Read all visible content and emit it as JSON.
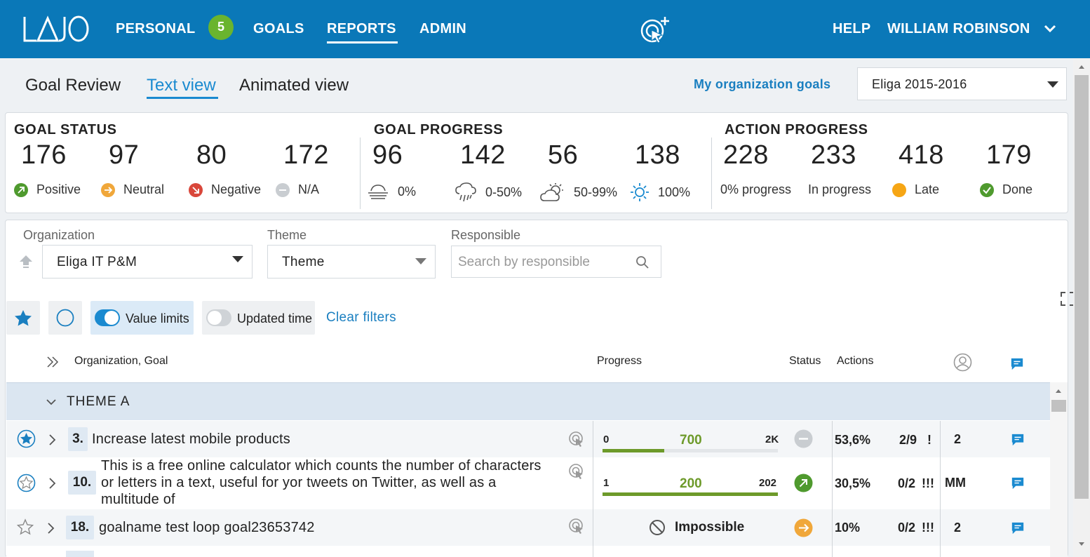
{
  "nav": {
    "logo_text": "LAJO",
    "personal": "PERSONAL",
    "personal_badge": "5",
    "goals": "GOALS",
    "reports": "REPORTS",
    "admin": "ADMIN",
    "help": "HELP",
    "user": "WILLIAM ROBINSON"
  },
  "header": {
    "title": "Goal Review",
    "tab_text": "Text view",
    "tab_animated": "Animated view",
    "org_goals_link": "My organization goals",
    "period": "Eliga 2015-2016"
  },
  "stats": {
    "goal_status": {
      "title": "GOAL STATUS",
      "items": [
        {
          "value": "176",
          "label": "Positive",
          "color": "#4f9a2e"
        },
        {
          "value": "97",
          "label": "Neutral",
          "color": "#f0a73a"
        },
        {
          "value": "80",
          "label": "Negative",
          "color": "#d9473b"
        },
        {
          "value": "172",
          "label": "N/A",
          "color": "#c9cdd1"
        }
      ]
    },
    "goal_progress": {
      "title": "GOAL PROGRESS",
      "items": [
        {
          "value": "96",
          "label": "0%",
          "icon": "fog-icon"
        },
        {
          "value": "142",
          "label": "0-50%",
          "icon": "rain-cloud-icon"
        },
        {
          "value": "56",
          "label": "50-99%",
          "icon": "partly-cloudy-icon"
        },
        {
          "value": "138",
          "label": "100%",
          "icon": "sun-icon"
        }
      ]
    },
    "action_progress": {
      "title": "ACTION PROGRESS",
      "items": [
        {
          "value": "228",
          "label": "0% progress"
        },
        {
          "value": "233",
          "label": "In progress"
        },
        {
          "value": "418",
          "label": "Late",
          "color": "#f6a615"
        },
        {
          "value": "179",
          "label": "Done",
          "color": "#4f9a2e"
        }
      ]
    }
  },
  "filters": {
    "organization_label": "Organization",
    "organization_value": "Eliga IT P&M",
    "theme_label": "Theme",
    "theme_value": "Theme",
    "responsible_label": "Responsible",
    "responsible_placeholder": "Search by responsible",
    "value_limits": "Value limits",
    "updated_time": "Updated time",
    "clear_filters": "Clear filters"
  },
  "table": {
    "headers": {
      "goal": "Organization, Goal",
      "progress": "Progress",
      "status": "Status",
      "actions": "Actions"
    },
    "theme": "THEME A",
    "rows": [
      {
        "no": "3.",
        "title": "Increase latest mobile products",
        "min": "0",
        "value": "700",
        "max": "2K",
        "progress": 0.35,
        "status": "na",
        "actions_pct": "53,6%",
        "actions_count": "2/9",
        "flag": "!",
        "resp": "2"
      },
      {
        "no": "10.",
        "title": "This is a free online calculator which counts the number of characters or letters in a text, useful for yor tweets on Twitter, as well as a multitude of",
        "min": "1",
        "value": "200",
        "max": "202",
        "progress": 1.0,
        "status": "positive",
        "actions_pct": "30,5%",
        "actions_count": "0/2",
        "flag": "!!!",
        "resp": "MM"
      },
      {
        "no": "18.",
        "title": "goalname test loop goal23653742",
        "impossible": "Impossible",
        "status": "neutral",
        "actions_pct": "10%",
        "actions_count": "0/2",
        "flag": "!!!",
        "resp": "2"
      }
    ]
  },
  "colors": {
    "topbar": "#0a78b8",
    "accent": "#1a8ad0",
    "positive": "#4f9a2e",
    "neutral": "#f0a73a",
    "negative": "#d9473b",
    "progress_bar": "#6d9a2a"
  }
}
